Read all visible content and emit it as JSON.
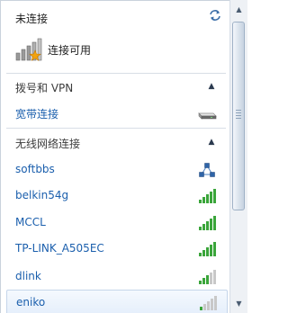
{
  "connection_status": {
    "title": "未连接",
    "subtitle": "连接可用"
  },
  "sections": {
    "dialup_vpn": {
      "title": "拨号和 VPN"
    },
    "wireless": {
      "title": "无线网络连接"
    }
  },
  "broadband": {
    "label": "宽带连接",
    "icon": "modem-icon"
  },
  "networks": [
    {
      "name": "softbbs",
      "icon": "adhoc-network-icon"
    },
    {
      "name": "belkin54g",
      "icon": "wifi-signal-icon",
      "signal_bars": 5
    },
    {
      "name": "MCCL",
      "icon": "wifi-signal-icon",
      "signal_bars": 5
    },
    {
      "name": "TP-LINK_A505EC",
      "icon": "wifi-signal-icon",
      "signal_bars": 5
    },
    {
      "name": "dlink",
      "icon": "wifi-signal-icon",
      "signal_bars": 3
    },
    {
      "name": "eniko",
      "icon": "wifi-signal-icon",
      "signal_bars": 1
    }
  ],
  "colors": {
    "link": "#1b5fad",
    "signal_on": "#3aa53a",
    "signal_off": "#c8c8c8",
    "star": "#f2a20e"
  }
}
